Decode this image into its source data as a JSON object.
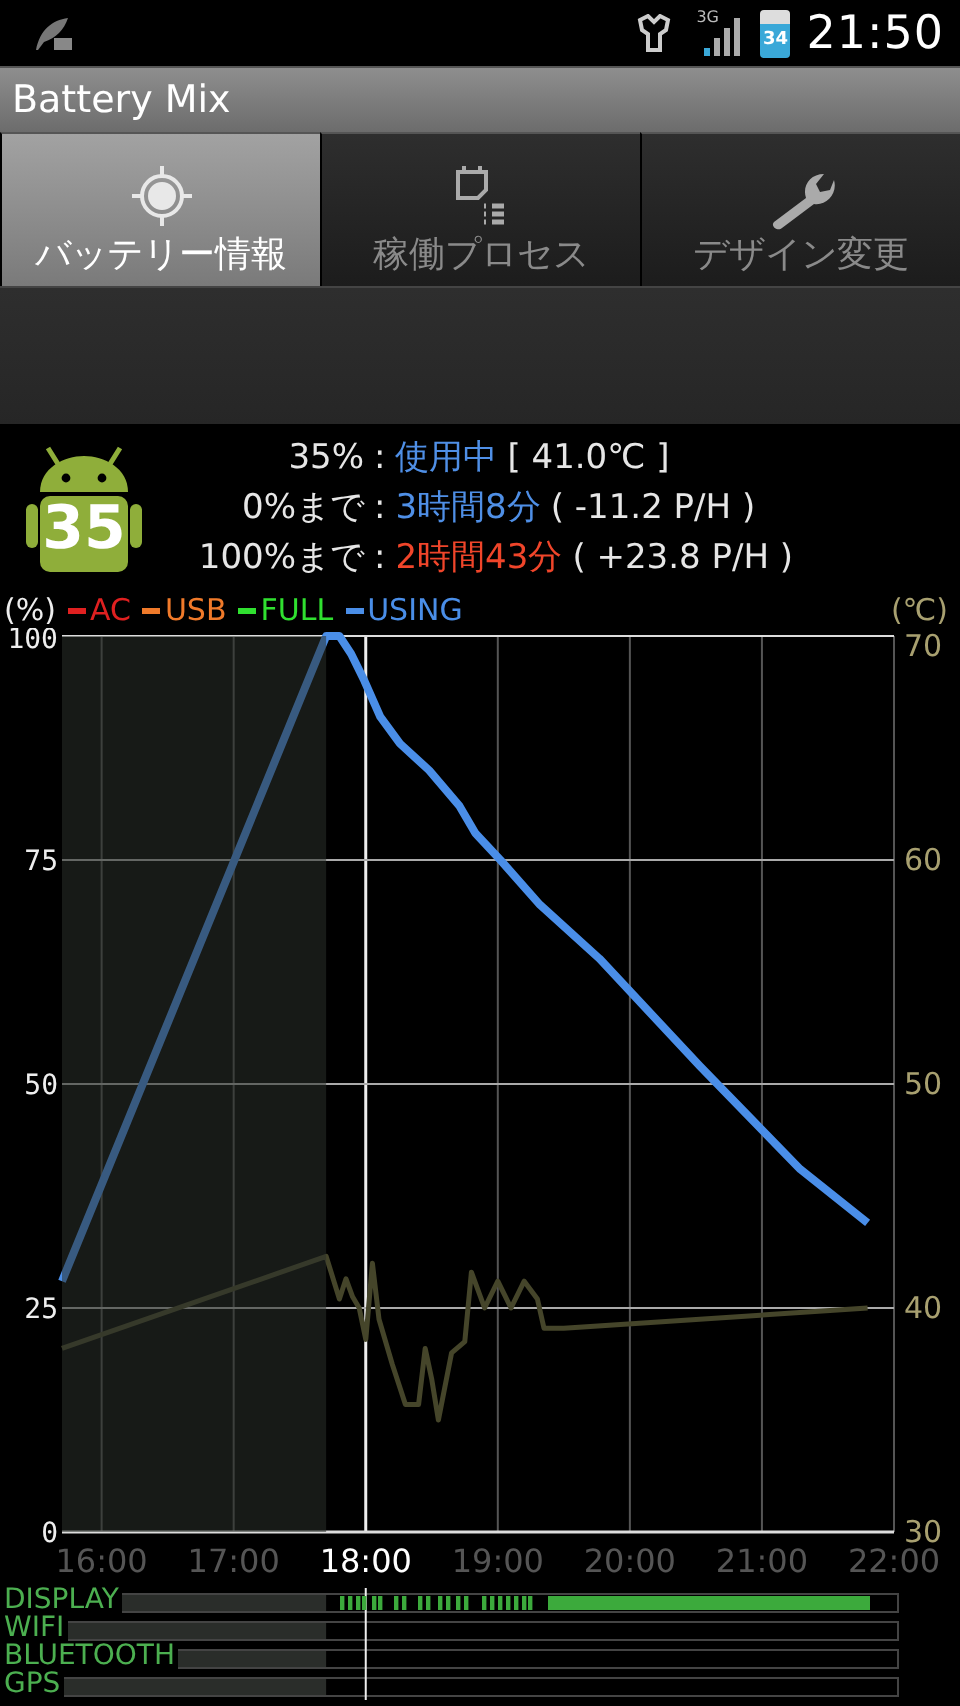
{
  "status_bar": {
    "network": "3G",
    "battery": "34",
    "time": "21:50"
  },
  "app_bar": {
    "title": "Battery Mix"
  },
  "tabs": [
    {
      "label": "バッテリー情報",
      "selected": true
    },
    {
      "label": "稼働プロセス",
      "selected": false
    },
    {
      "label": "デザイン変更",
      "selected": false
    }
  ],
  "info": {
    "badge": "35",
    "rows": [
      {
        "label": "35%",
        "separator": ":",
        "value": "使用中",
        "color": "#4f8fe6",
        "extra": "[ 41.0℃ ]"
      },
      {
        "label": "0%まで",
        "separator": ":",
        "value": "3時間8分",
        "color": "#4f8fe6",
        "extra": "( -11.2 P/H )"
      },
      {
        "label": "100%まで",
        "separator": ":",
        "value": "2時間43分",
        "color": "#f0452a",
        "extra": "( +23.8 P/H )"
      }
    ]
  },
  "legend": [
    {
      "label": "AC",
      "color": "#e02020"
    },
    {
      "label": "USB",
      "color": "#f07a2a"
    },
    {
      "label": "FULL",
      "color": "#30e030"
    },
    {
      "label": "USING",
      "color": "#4a8ee8"
    }
  ],
  "chart_data": {
    "type": "line",
    "grid": true,
    "ylabel": "(%)",
    "y2label": "(℃)",
    "xlim": [
      15.7,
      22
    ],
    "ylim": [
      0,
      100
    ],
    "y2lim": [
      30,
      70
    ],
    "xticks": [
      {
        "value": 16,
        "label": "16:00"
      },
      {
        "value": 17,
        "label": "17:00"
      },
      {
        "value": 18,
        "label": "18:00"
      },
      {
        "value": 19,
        "label": "19:00"
      },
      {
        "value": 20,
        "label": "20:00"
      },
      {
        "value": 21,
        "label": "21:00"
      },
      {
        "value": 22,
        "label": "22:00"
      }
    ],
    "yticks": [
      0,
      25,
      50,
      75,
      100
    ],
    "y2ticks": [
      30,
      40,
      50,
      60,
      70
    ],
    "series": [
      {
        "color": "#4a8ee8",
        "x": [
          15.7,
          17.7,
          17.8,
          17.89,
          17.99,
          18.11,
          18.26,
          18.48,
          18.71,
          18.83,
          19.02,
          19.32,
          19.77,
          20.53,
          21.29,
          21.8
        ],
        "values": [
          28,
          100,
          100,
          98,
          95,
          91,
          88,
          85,
          81,
          78,
          75,
          70,
          64,
          52,
          40.5,
          34.5
        ]
      },
      {
        "color": "#45452a",
        "axis": "y2",
        "x": [
          15.7,
          17.7,
          17.8,
          17.85,
          17.9,
          17.95,
          18.0,
          18.05,
          18.1,
          18.2,
          18.3,
          18.4,
          18.45,
          18.5,
          18.55,
          18.65,
          18.75,
          18.8,
          18.9,
          19.0,
          19.1,
          19.2,
          19.3,
          19.35,
          19.5,
          21.8
        ],
        "values": [
          38.2,
          42.3,
          40.4,
          41.3,
          40.5,
          40.0,
          38.6,
          42.0,
          39.5,
          37.5,
          35.7,
          35.7,
          38.2,
          36.8,
          35.0,
          38.0,
          38.5,
          41.6,
          40.0,
          41.2,
          40.0,
          41.2,
          40.4,
          39.1,
          39.1,
          40.0
        ]
      }
    ],
    "bands": [
      {
        "axis": "x",
        "from": 15.7,
        "to": 17.7
      }
    ],
    "ref_lines": [
      {
        "axis": "x",
        "value": 18
      }
    ]
  },
  "activity": [
    {
      "label": "DISPLAY",
      "kind": "activity"
    },
    {
      "label": "WIFI",
      "kind": "idle"
    },
    {
      "label": "BLUETOOTH",
      "kind": "idle"
    },
    {
      "label": "GPS",
      "kind": "idle"
    }
  ]
}
